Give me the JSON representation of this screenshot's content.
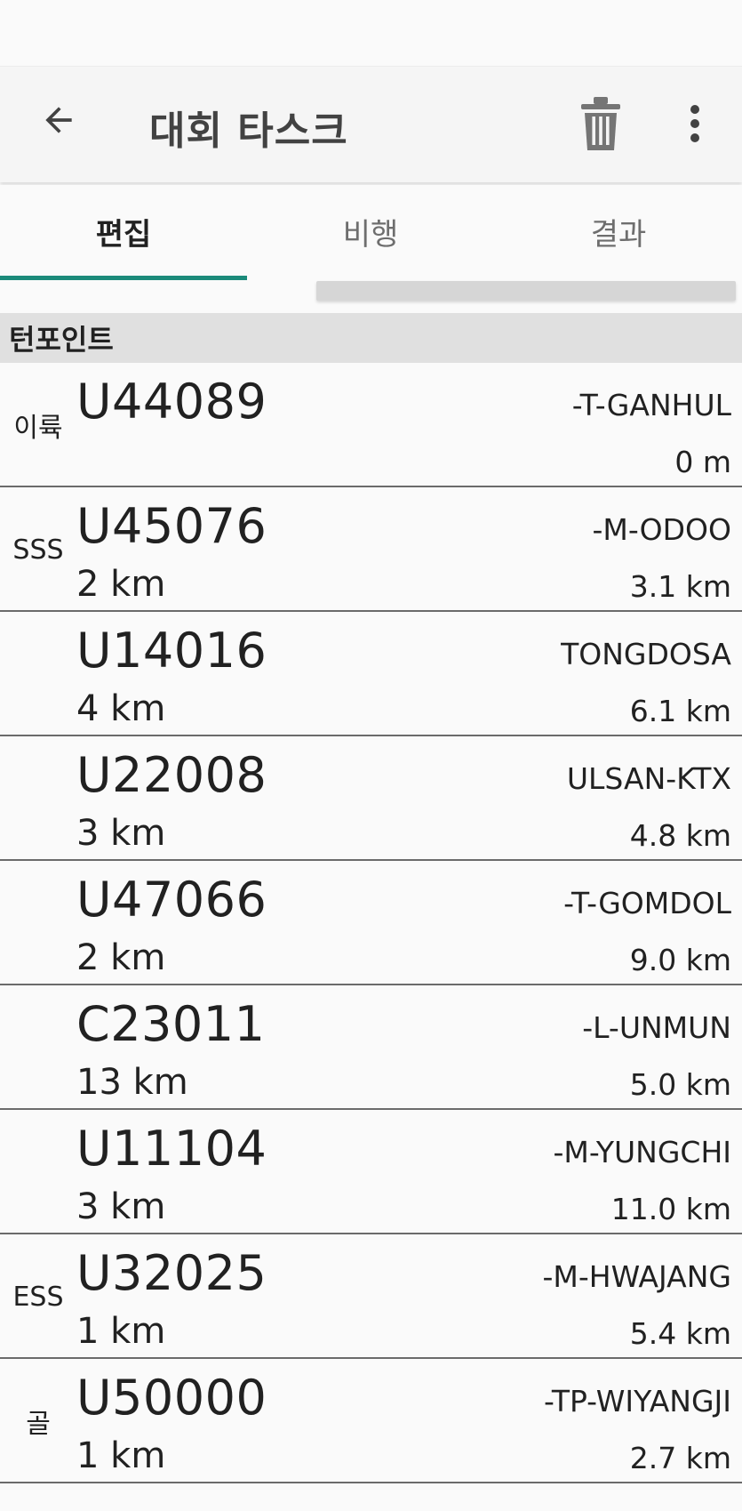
{
  "app_bar": {
    "title": "대회 타스크",
    "back_icon": "arrow-left-icon",
    "delete_icon": "trash-icon",
    "more_icon": "more-vertical-icon"
  },
  "tabs": [
    {
      "label": "편집",
      "active": true
    },
    {
      "label": "비행",
      "active": false
    },
    {
      "label": "결과",
      "active": false
    }
  ],
  "accent_color": "#1b8a7a",
  "section": {
    "title": "턴포인트"
  },
  "waypoints": [
    {
      "tag": "이륙",
      "id": "U44089",
      "leg": "",
      "name": "-T-GANHUL",
      "cumulative": "0 m"
    },
    {
      "tag": "SSS",
      "id": "U45076",
      "leg": "2 km",
      "name": "-M-ODOO",
      "cumulative": "3.1 km"
    },
    {
      "tag": "",
      "id": "U14016",
      "leg": "4 km",
      "name": "TONGDOSA",
      "cumulative": "6.1 km"
    },
    {
      "tag": "",
      "id": "U22008",
      "leg": "3 km",
      "name": "ULSAN-KTX",
      "cumulative": "4.8 km"
    },
    {
      "tag": "",
      "id": "U47066",
      "leg": "2 km",
      "name": "-T-GOMDOL",
      "cumulative": "9.0 km"
    },
    {
      "tag": "",
      "id": "C23011",
      "leg": "13 km",
      "name": "-L-UNMUN",
      "cumulative": "5.0 km"
    },
    {
      "tag": "",
      "id": "U11104",
      "leg": "3 km",
      "name": "-M-YUNGCHI",
      "cumulative": "11.0 km"
    },
    {
      "tag": "ESS",
      "id": "U32025",
      "leg": "1 km",
      "name": "-M-HWAJANG",
      "cumulative": "5.4 km"
    },
    {
      "tag": "골",
      "id": "U50000",
      "leg": "1 km",
      "name": "-TP-WIYANGJI",
      "cumulative": "2.7 km"
    }
  ]
}
